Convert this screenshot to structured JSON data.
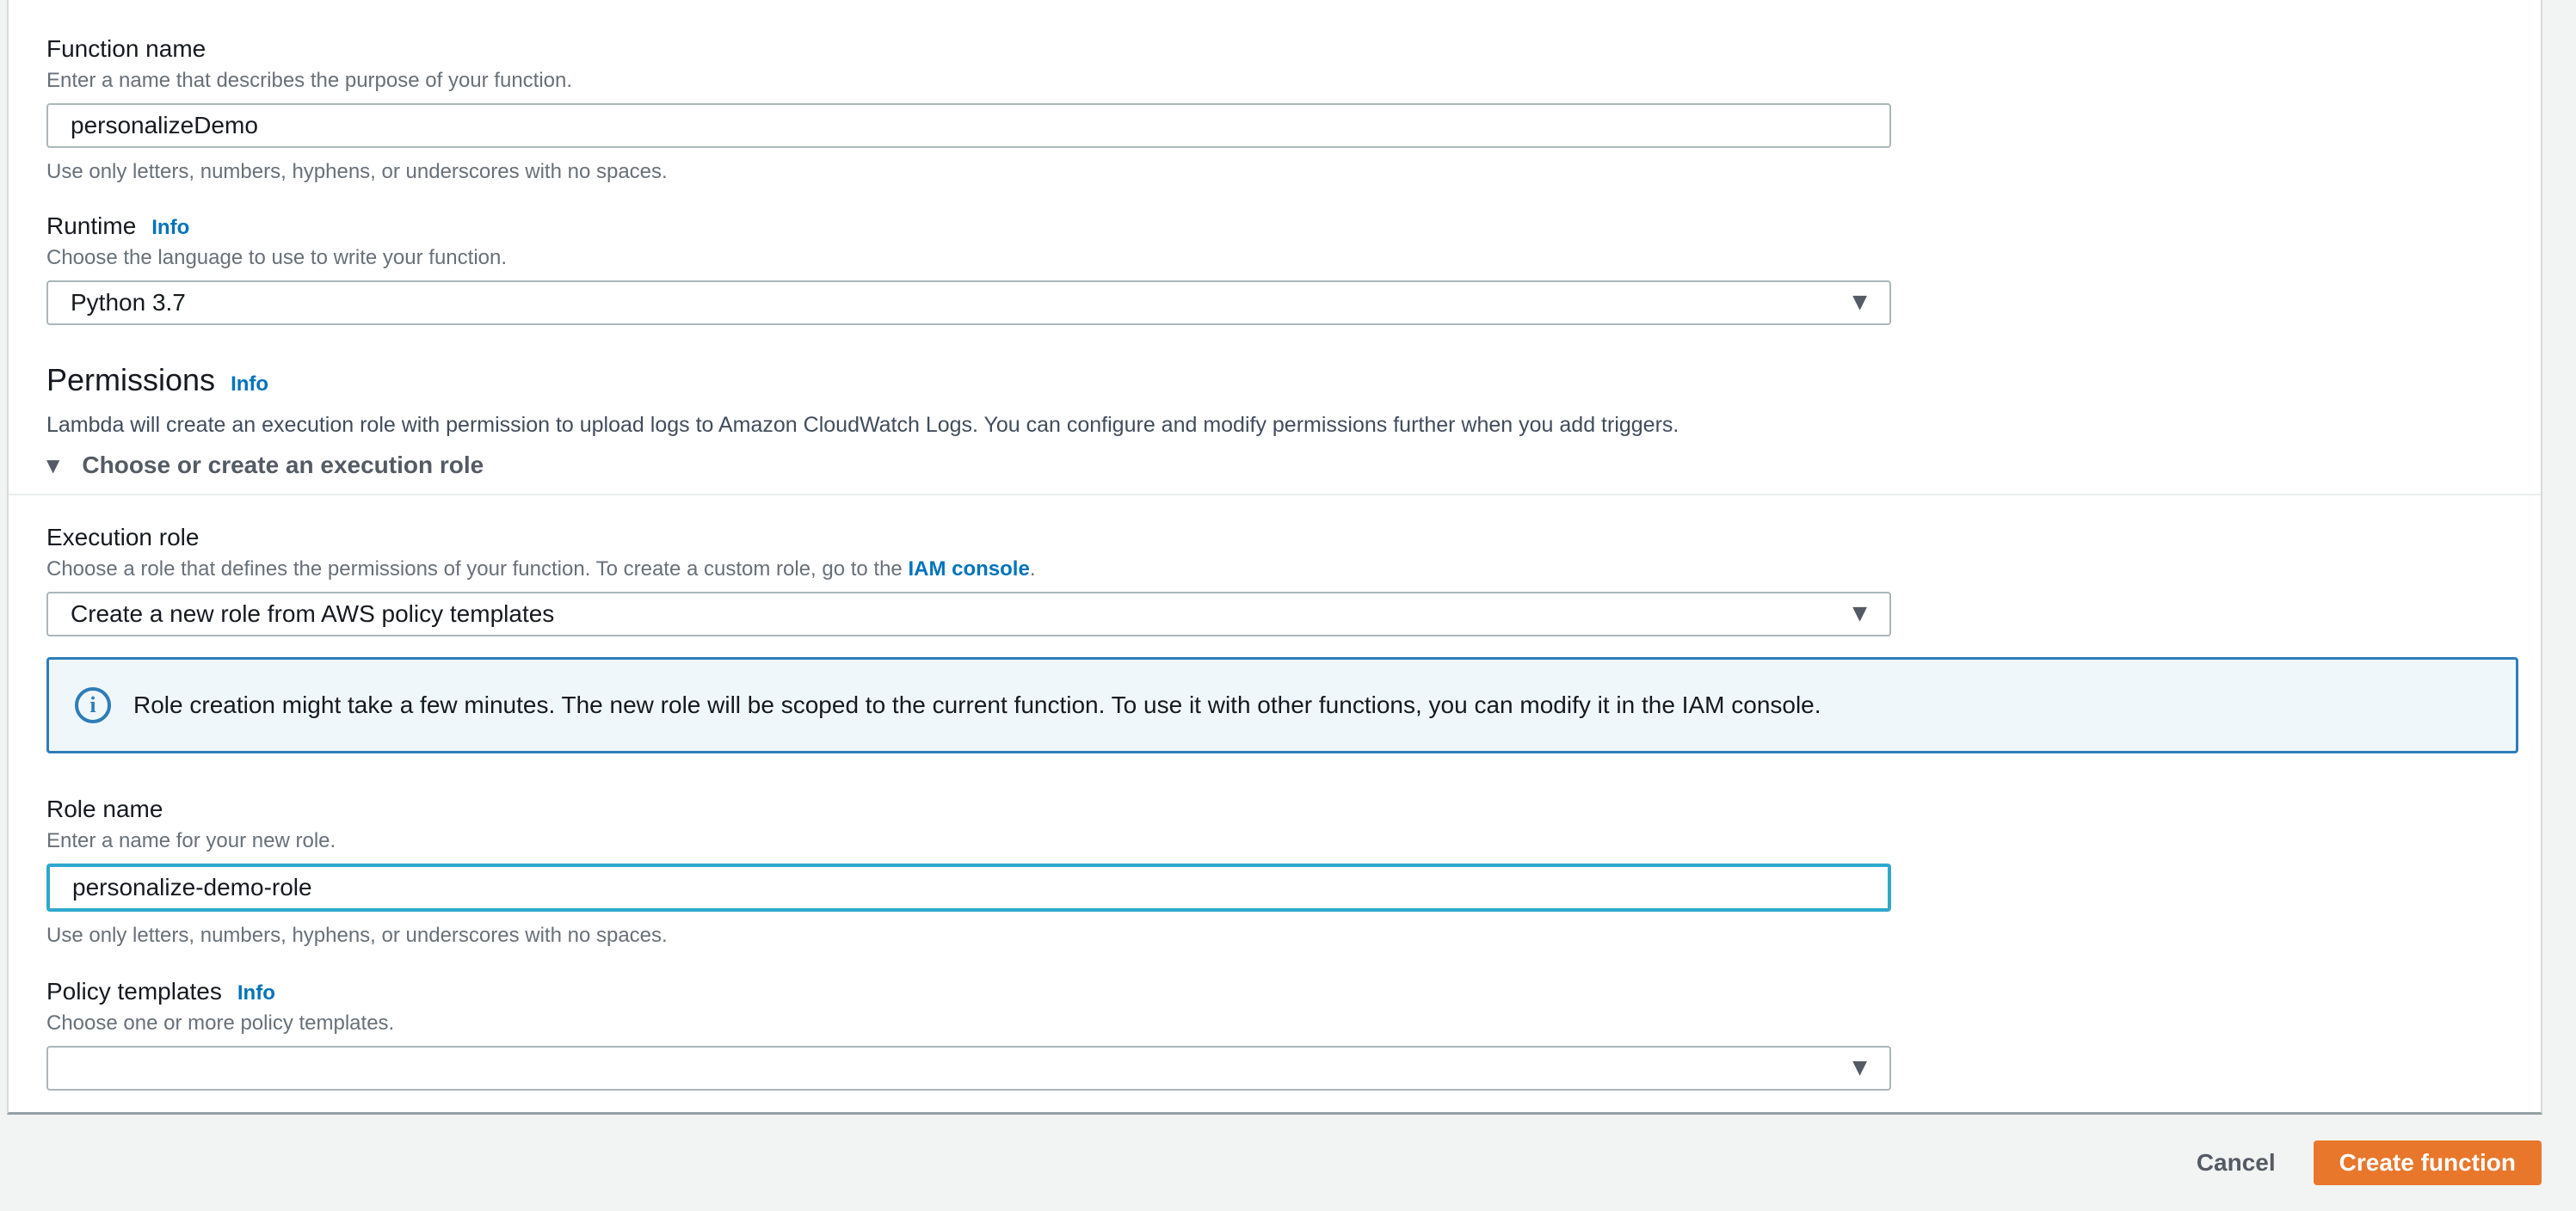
{
  "form": {
    "function_name": {
      "label": "Function name",
      "description": "Enter a name that describes the purpose of your function.",
      "value": "personalizeDemo",
      "helper": "Use only letters, numbers, hyphens, or underscores with no spaces."
    },
    "runtime": {
      "label": "Runtime",
      "info_label": "Info",
      "description": "Choose the language to use to write your function.",
      "value": "Python 3.7"
    },
    "permissions": {
      "heading": "Permissions",
      "info_label": "Info",
      "description": "Lambda will create an execution role with permission to upload logs to Amazon CloudWatch Logs. You can configure and modify permissions further when you add triggers.",
      "expander_label": "Choose or create an execution role"
    },
    "execution_role": {
      "label": "Execution role",
      "description_prefix": "Choose a role that defines the permissions of your function. To create a custom role, go to the ",
      "link_label": "IAM console",
      "description_suffix": ".",
      "value": "Create a new role from AWS policy templates"
    },
    "alert": {
      "text": "Role creation might take a few minutes. The new role will be scoped to the current function. To use it with other functions, you can modify it in the IAM console."
    },
    "role_name": {
      "label": "Role name",
      "description": "Enter a name for your new role.",
      "value": "personalize-demo-role",
      "helper": "Use only letters, numbers, hyphens, or underscores with no spaces."
    },
    "policy_templates": {
      "label": "Policy templates",
      "info_label": "Info",
      "description": "Choose one or more policy templates.",
      "value": ""
    }
  },
  "footer": {
    "cancel_label": "Cancel",
    "create_label": "Create function"
  },
  "icons": {
    "dropdown_caret": "▼",
    "expander_caret": "▼",
    "info": "i"
  },
  "colors": {
    "accent_orange": "#e8772c",
    "link_blue": "#0073bb",
    "focus_border": "#2fa8cc",
    "alert_border": "#2e7db8",
    "alert_bg": "#f0f7fb",
    "page_bg": "#f2f3f3"
  }
}
